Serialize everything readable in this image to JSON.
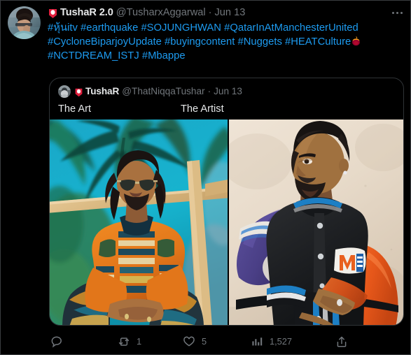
{
  "theme": {
    "background": "#000000",
    "text_primary": "#e7e9ea",
    "text_secondary": "#71767b",
    "link_blue": "#1d9bf0",
    "border": "#2f3336"
  },
  "tweet": {
    "author": {
      "display_name": "TushaR 2.0",
      "handle": "@TusharxAggarwal",
      "separator": "·",
      "timestamp": "Jun 13",
      "avatar_name": "author-avatar",
      "name_emoji": "pin-emoji"
    },
    "more_menu_label": "More",
    "text_lines": [
      [
        {
          "type": "hashtag",
          "text": "#หุ้นitv"
        },
        {
          "type": "space",
          "text": " "
        },
        {
          "type": "hashtag",
          "text": "#earthquake"
        },
        {
          "type": "space",
          "text": " "
        },
        {
          "type": "hashtag",
          "text": "#SOJUNGHWAN"
        },
        {
          "type": "space",
          "text": " "
        },
        {
          "type": "hashtag",
          "text": "#QatarInAtManchesterUnited"
        }
      ],
      [
        {
          "type": "hashtag",
          "text": "#CycloneBiparjoyUpdate"
        },
        {
          "type": "space",
          "text": " "
        },
        {
          "type": "hashtag",
          "text": "#buyingcontent"
        },
        {
          "type": "space",
          "text": " "
        },
        {
          "type": "hashtag",
          "text": "#Nuggets"
        },
        {
          "type": "space",
          "text": " "
        },
        {
          "type": "hashtag",
          "text": "#HEATCulture"
        },
        {
          "type": "emoji",
          "text": "heat-logo-emoji"
        }
      ],
      [
        {
          "type": "hashtag",
          "text": "#NCTDREAM_ISTJ"
        },
        {
          "type": "space",
          "text": " "
        },
        {
          "type": "hashtag",
          "text": "#Mbappe"
        }
      ]
    ],
    "text_plain": "#หุ้นitv #earthquake #SOJUNGHWAN #QatarInAtManchesterUnited #CycloneBiparjoyUpdate #buyingcontent #Nuggets #HEATCulture🏀 #NCTDREAM_ISTJ #Mbappe"
  },
  "quoted_tweet": {
    "author": {
      "display_name": "TushaR",
      "handle": "@ThatNiqqaTushar",
      "separator": "·",
      "timestamp": "Jun 13",
      "avatar_name": "quoted-author-avatar",
      "name_emoji": "pin-emoji"
    },
    "text_segment_a": "The Art",
    "text_segment_b": "The Artist",
    "media": [
      {
        "name": "photo-the-art",
        "alt": "Man in orange dashiki with sunglasses sitting under palm trees against turquoise sky"
      },
      {
        "name": "photo-the-artist",
        "alt": "Man in black varsity jacket with purple and orange sleeves leaning against beige wall"
      }
    ]
  },
  "actions": [
    {
      "name": "reply",
      "icon": "reply-icon",
      "count": ""
    },
    {
      "name": "retweet",
      "icon": "retweet-icon",
      "count": "1"
    },
    {
      "name": "like",
      "icon": "heart-icon",
      "count": "5"
    },
    {
      "name": "views",
      "icon": "analytics-icon",
      "count": "1,527"
    },
    {
      "name": "share",
      "icon": "share-icon",
      "count": ""
    }
  ]
}
